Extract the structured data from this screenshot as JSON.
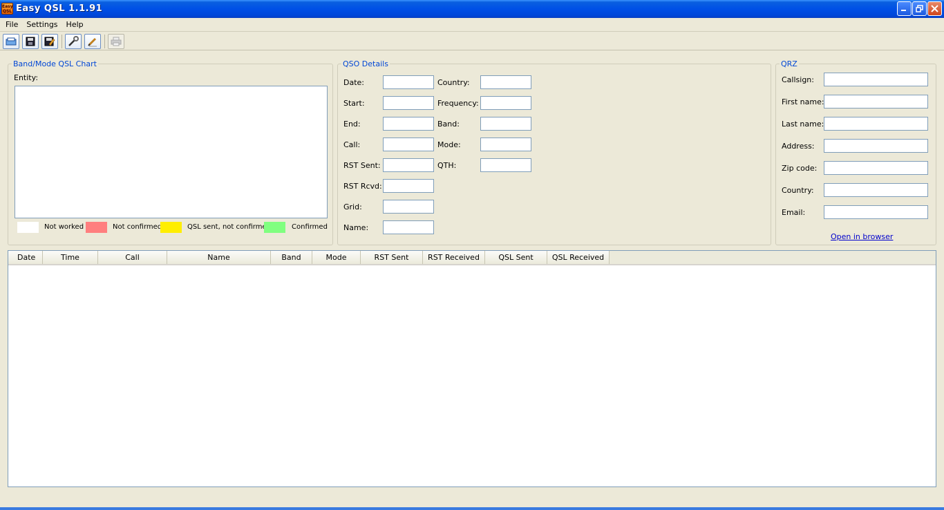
{
  "window": {
    "title": "Easy QSL 1.1.91",
    "app_icon_text": "Easy QSL"
  },
  "menu": [
    {
      "label": "File"
    },
    {
      "label": "Settings"
    },
    {
      "label": "Help"
    }
  ],
  "toolbar": {
    "buttons": [
      {
        "icon": "open-icon"
      },
      {
        "icon": "save-icon"
      },
      {
        "icon": "save-as-icon"
      },
      {
        "icon": "settings-wrench-icon"
      },
      {
        "icon": "edit-pen-icon"
      },
      {
        "icon": "print-icon",
        "disabled": true
      }
    ]
  },
  "chart_panel": {
    "title": "Band/Mode QSL Chart",
    "entity_label": "Entity:",
    "legend": [
      {
        "label": "Not worked",
        "color": "#ffffff"
      },
      {
        "label": "Not confirmed",
        "color": "#ff7f7f"
      },
      {
        "label": "QSL sent, not confirmed",
        "color": "#ffee00"
      },
      {
        "label": "Confirmed",
        "color": "#80ff80"
      }
    ]
  },
  "qso_panel": {
    "title": "QSO Details",
    "left_fields": [
      {
        "label": "Date:",
        "value": ""
      },
      {
        "label": "Start:",
        "value": ""
      },
      {
        "label": "End:",
        "value": ""
      },
      {
        "label": "Call:",
        "value": ""
      },
      {
        "label": "RST Sent:",
        "value": ""
      },
      {
        "label": "RST Rcvd:",
        "value": ""
      },
      {
        "label": "Grid:",
        "value": ""
      },
      {
        "label": "Name:",
        "value": ""
      }
    ],
    "right_fields": [
      {
        "label": "Country:",
        "value": ""
      },
      {
        "label": "Frequency:",
        "value": ""
      },
      {
        "label": "Band:",
        "value": ""
      },
      {
        "label": "Mode:",
        "value": ""
      },
      {
        "label": "QTH:",
        "value": ""
      }
    ]
  },
  "qrz_panel": {
    "title": "QRZ",
    "fields": [
      {
        "label": "Callsign:",
        "value": ""
      },
      {
        "label": "First name:",
        "value": ""
      },
      {
        "label": "Last name:",
        "value": ""
      },
      {
        "label": "Address:",
        "value": ""
      },
      {
        "label": "Zip code:",
        "value": ""
      },
      {
        "label": "Country:",
        "value": ""
      },
      {
        "label": "Email:",
        "value": ""
      }
    ],
    "link": "Open in browser"
  },
  "log_table": {
    "columns": [
      "Date",
      "Time",
      "Call",
      "Name",
      "Band",
      "Mode",
      "RST Sent",
      "RST Received",
      "QSL Sent",
      "QSL Received"
    ],
    "rows": []
  }
}
